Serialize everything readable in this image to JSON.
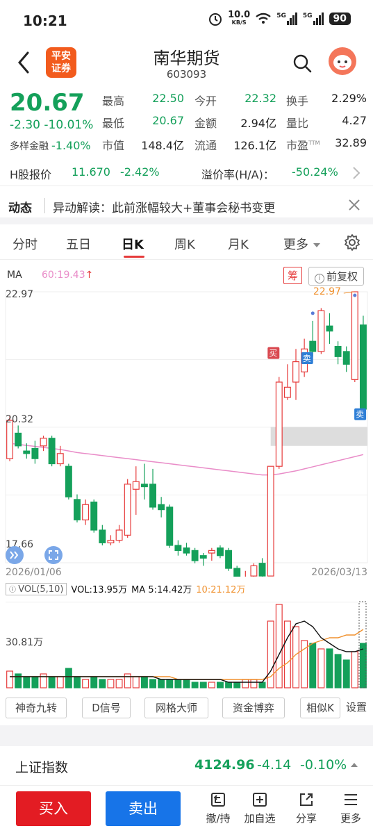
{
  "status": {
    "time": "10:21",
    "net_speed": "10.0",
    "net_unit": "KB/S",
    "sig1": "5G",
    "sig2": "5G",
    "battery": "90"
  },
  "header": {
    "logo_line1": "平安",
    "logo_line2": "证券",
    "name": "南华期货",
    "code": "603093"
  },
  "quote": {
    "price": "20.67",
    "change": "-2.30",
    "change_pct": "-10.01%",
    "sector_name": "多样金融",
    "sector_pct": "-1.40%",
    "stats": [
      {
        "k": "最高",
        "v": "22.50",
        "color": "green"
      },
      {
        "k": "今开",
        "v": "22.32",
        "color": "green"
      },
      {
        "k": "换手",
        "v": "2.29%",
        "color": "normal"
      },
      {
        "k": "最低",
        "v": "20.67",
        "color": "green"
      },
      {
        "k": "金额",
        "v": "2.94亿",
        "color": "normal"
      },
      {
        "k": "量比",
        "v": "4.27",
        "color": "normal"
      },
      {
        "k": "市值",
        "v": "148.4亿",
        "color": "normal"
      },
      {
        "k": "流通",
        "v": "126.1亿",
        "color": "normal"
      },
      {
        "k": "市盈",
        "v": "32.89",
        "color": "normal",
        "sup": "TTM"
      }
    ]
  },
  "hk": {
    "label": "H股报价",
    "price": "11.670",
    "pct": "-2.42%",
    "premium_label": "溢价率(H/A)：",
    "premium": "-50.24%"
  },
  "news": {
    "tag": "动态",
    "text": "异动解读：此前涨幅较大+董事会秘书变更"
  },
  "tabs": [
    "分时",
    "五日",
    "日K",
    "周K",
    "月K",
    "更多"
  ],
  "chart": {
    "ma_label": "MA",
    "ma60": "60:19.43",
    "chou": "筹",
    "fq": "前复权",
    "y_max": "22.97",
    "y_mid": "20.32",
    "y_min": "17.66",
    "max_mark": "22.97",
    "min_mark": "17.66",
    "buy_tag": "买",
    "sell_tag": "卖",
    "date_start": "2026/01/06",
    "date_end": "2026/03/13",
    "vol_indicator": "VOL(5,10)",
    "vol_value": "VOL:13.95万",
    "vol_ma5": "MA 5:14.42万",
    "vol_ma10": "10:21.12万",
    "vol_axis": "30.81万",
    "colors": {
      "up": "#e63b3b",
      "down": "#14a05a",
      "ma60": "#e98cc8",
      "ma5": "#111111",
      "ma10": "#f0912e"
    }
  },
  "chart_data": {
    "type": "candlestick",
    "title": "",
    "x": [
      "2026/01/06",
      "2026/03/13"
    ],
    "ylim": [
      17.66,
      22.97
    ],
    "candles": [
      {
        "o": 19.7,
        "c": 20.45,
        "h": 20.55,
        "l": 19.65
      },
      {
        "o": 20.2,
        "c": 19.95,
        "h": 20.35,
        "l": 19.9
      },
      {
        "o": 19.85,
        "c": 19.8,
        "h": 20.0,
        "l": 19.7
      },
      {
        "o": 19.9,
        "c": 19.7,
        "h": 20.05,
        "l": 19.6
      },
      {
        "o": 19.95,
        "c": 20.1,
        "h": 20.15,
        "l": 19.85
      },
      {
        "o": 20.1,
        "c": 19.6,
        "h": 20.15,
        "l": 19.55
      },
      {
        "o": 19.6,
        "c": 19.8,
        "h": 19.95,
        "l": 19.55
      },
      {
        "o": 19.55,
        "c": 18.95,
        "h": 19.6,
        "l": 18.9
      },
      {
        "o": 18.9,
        "c": 18.5,
        "h": 19.0,
        "l": 18.45
      },
      {
        "o": 18.5,
        "c": 18.8,
        "h": 18.9,
        "l": 18.4
      },
      {
        "o": 18.85,
        "c": 18.3,
        "h": 18.9,
        "l": 18.25
      },
      {
        "o": 18.3,
        "c": 18.05,
        "h": 18.4,
        "l": 18.0
      },
      {
        "o": 18.05,
        "c": 18.1,
        "h": 18.2,
        "l": 18.0
      },
      {
        "o": 18.1,
        "c": 18.3,
        "h": 18.4,
        "l": 18.05
      },
      {
        "o": 18.2,
        "c": 19.2,
        "h": 19.3,
        "l": 18.15
      },
      {
        "o": 19.1,
        "c": 19.25,
        "h": 19.55,
        "l": 18.6
      },
      {
        "o": 19.2,
        "c": 19.15,
        "h": 19.6,
        "l": 18.9
      },
      {
        "o": 19.2,
        "c": 18.75,
        "h": 19.5,
        "l": 18.7
      },
      {
        "o": 18.8,
        "c": 18.7,
        "h": 18.95,
        "l": 18.55
      },
      {
        "o": 18.75,
        "c": 18.0,
        "h": 18.8,
        "l": 17.95
      },
      {
        "o": 18.0,
        "c": 17.9,
        "h": 18.1,
        "l": 17.8
      },
      {
        "o": 17.95,
        "c": 17.85,
        "h": 18.05,
        "l": 17.8
      },
      {
        "o": 17.9,
        "c": 17.7,
        "h": 17.95,
        "l": 17.65
      },
      {
        "o": 17.8,
        "c": 17.75,
        "h": 17.85,
        "l": 17.6
      },
      {
        "o": 17.85,
        "c": 17.9,
        "h": 17.95,
        "l": 17.7
      },
      {
        "o": 17.95,
        "c": 17.8,
        "h": 18.0,
        "l": 17.75
      },
      {
        "o": 17.9,
        "c": 17.55,
        "h": 17.95,
        "l": 17.5
      },
      {
        "o": 17.55,
        "c": 17.25,
        "h": 17.6,
        "l": 17.2
      },
      {
        "o": 17.25,
        "c": 17.35,
        "h": 17.5,
        "l": 17.2
      },
      {
        "o": 17.4,
        "c": 17.6,
        "h": 17.65,
        "l": 17.35
      },
      {
        "o": 17.65,
        "c": 17.4,
        "h": 17.75,
        "l": 17.3
      },
      {
        "o": 17.4,
        "c": 19.55,
        "h": 19.55,
        "l": 17.4
      },
      {
        "o": 19.55,
        "c": 21.2,
        "h": 21.3,
        "l": 19.5
      },
      {
        "o": 20.9,
        "c": 21.1,
        "h": 21.55,
        "l": 20.85
      },
      {
        "o": 21.2,
        "c": 21.6,
        "h": 21.85,
        "l": 20.85
      },
      {
        "o": 21.4,
        "c": 21.85,
        "h": 22.05,
        "l": 21.3
      },
      {
        "o": 22.0,
        "c": 21.8,
        "h": 22.4,
        "l": 21.7
      },
      {
        "o": 21.8,
        "c": 22.6,
        "h": 22.65,
        "l": 21.75
      },
      {
        "o": 22.3,
        "c": 22.2,
        "h": 22.55,
        "l": 21.95
      },
      {
        "o": 21.9,
        "c": 21.7,
        "h": 22.0,
        "l": 21.55
      },
      {
        "o": 21.8,
        "c": 21.55,
        "h": 21.9,
        "l": 21.4
      },
      {
        "o": 21.25,
        "c": 22.97,
        "h": 22.97,
        "l": 21.2
      },
      {
        "o": 22.32,
        "c": 20.67,
        "h": 22.5,
        "l": 20.67
      }
    ],
    "ma60": [
      20.0,
      19.98,
      19.96,
      19.94,
      19.92,
      19.9,
      19.88,
      19.85,
      19.82,
      19.8,
      19.78,
      19.76,
      19.74,
      19.72,
      19.7,
      19.68,
      19.66,
      19.64,
      19.62,
      19.6,
      19.58,
      19.56,
      19.54,
      19.52,
      19.5,
      19.48,
      19.46,
      19.44,
      19.42,
      19.4,
      19.38,
      19.38,
      19.4,
      19.43,
      19.46,
      19.5,
      19.54,
      19.58,
      19.62,
      19.66,
      19.7,
      19.74,
      19.78
    ],
    "volume": [
      6,
      5,
      4,
      4,
      5,
      4,
      4,
      7,
      4,
      3,
      4,
      3,
      3,
      3,
      5,
      4,
      4,
      3,
      3,
      3,
      3,
      3,
      2,
      2,
      2,
      2,
      2,
      2,
      3,
      3,
      2,
      24,
      30,
      24,
      22,
      17,
      16,
      14,
      14,
      12,
      10,
      13,
      16
    ],
    "vol_ma5": [
      4,
      4,
      4,
      4,
      4,
      4,
      4,
      4,
      4,
      4,
      4,
      4,
      4,
      4,
      4,
      4,
      4,
      4,
      3,
      3,
      3,
      3,
      3,
      3,
      3,
      3,
      2,
      2,
      2,
      2,
      2,
      6,
      12,
      18,
      23,
      24,
      22,
      18,
      16,
      14,
      13,
      13,
      14
    ],
    "vol_ma10": [
      4,
      4,
      4,
      4,
      4,
      4,
      4,
      4,
      4,
      4,
      4,
      4,
      4,
      4,
      4,
      4,
      4,
      4,
      4,
      4,
      3,
      3,
      3,
      3,
      3,
      3,
      3,
      3,
      3,
      3,
      3,
      4,
      7,
      9,
      12,
      14,
      16,
      17,
      18,
      18,
      19,
      19,
      21
    ],
    "y_vol_max": 30.81
  },
  "indicators": [
    "神奇九转",
    "D信号",
    "网格大师",
    "资金博弈",
    "相似K",
    "设置"
  ],
  "index": {
    "name": "上证指数",
    "value": "4124.96",
    "change": "-4.14",
    "pct": "-0.10%"
  },
  "bottom": {
    "buy": "买入",
    "sell": "卖出",
    "items": [
      "撤/持",
      "加自选",
      "分享",
      "更多"
    ]
  }
}
